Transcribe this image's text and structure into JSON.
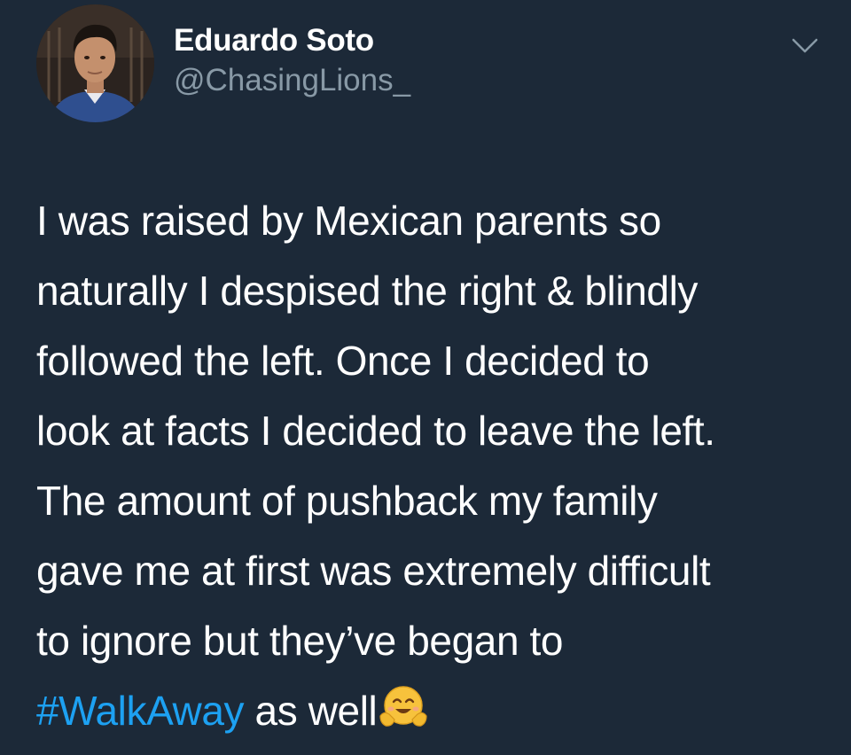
{
  "user": {
    "display_name": "Eduardo Soto",
    "handle": "@ChasingLions_",
    "avatar_icon": "profile-photo"
  },
  "menu": {
    "icon": "chevron-down-icon"
  },
  "tweet": {
    "lines": [
      "I was raised by Mexican parents so",
      "naturally I despised the right & blindly",
      "followed the left. Once I decided to",
      "look at facts I decided to leave the left.",
      "The amount of pushback my family",
      "gave me at first was extremely difficult",
      "to ignore but they’ve began to"
    ],
    "hashtag": "#WalkAway",
    "closing_text": " as well",
    "emoji": "hugging-face-emoji"
  },
  "colors": {
    "background": "#1c2938",
    "text": "#ffffff",
    "secondary_text": "#8899a6",
    "hashtag": "#1da1f2"
  }
}
